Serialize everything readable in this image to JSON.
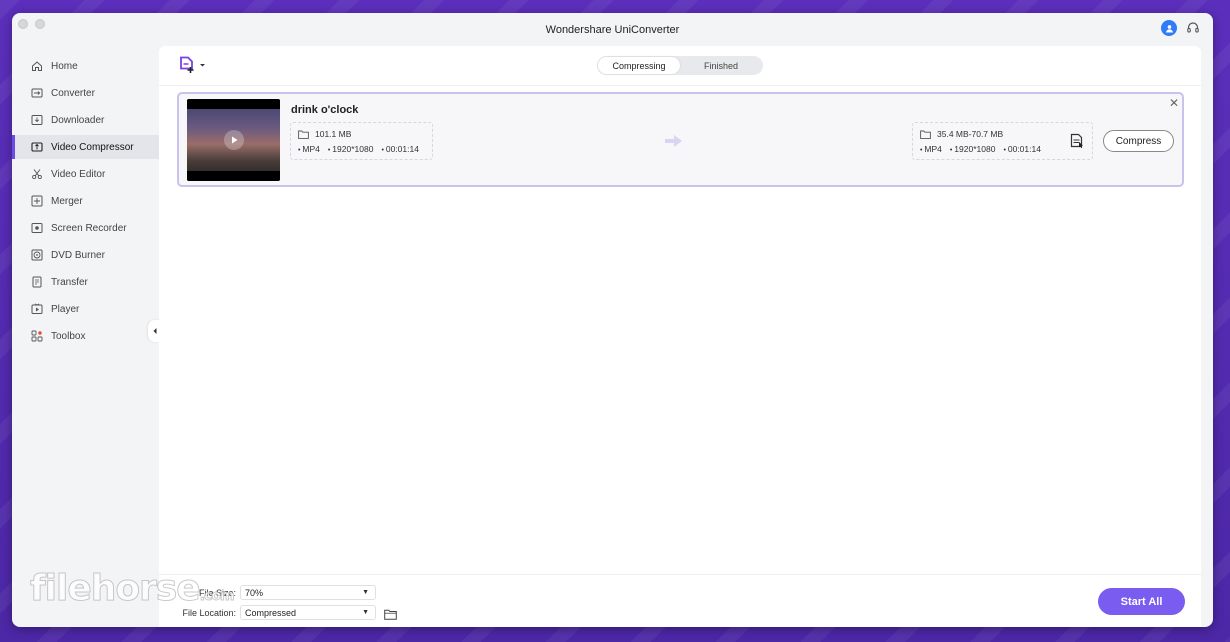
{
  "app": {
    "title": "Wondershare UniConverter"
  },
  "sidebar": {
    "items": [
      {
        "label": "Home",
        "icon": "home-icon"
      },
      {
        "label": "Converter",
        "icon": "converter-icon"
      },
      {
        "label": "Downloader",
        "icon": "downloader-icon"
      },
      {
        "label": "Video Compressor",
        "icon": "compressor-icon",
        "active": true
      },
      {
        "label": "Video Editor",
        "icon": "scissors-icon"
      },
      {
        "label": "Merger",
        "icon": "merger-icon"
      },
      {
        "label": "Screen Recorder",
        "icon": "screen-recorder-icon"
      },
      {
        "label": "DVD Burner",
        "icon": "disc-icon"
      },
      {
        "label": "Transfer",
        "icon": "transfer-icon"
      },
      {
        "label": "Player",
        "icon": "player-icon"
      },
      {
        "label": "Toolbox",
        "icon": "toolbox-icon"
      }
    ]
  },
  "tabs": [
    {
      "label": "Compressing",
      "active": true
    },
    {
      "label": "Finished",
      "active": false
    }
  ],
  "task": {
    "name": "drink o'clock",
    "source": {
      "size": "101.1 MB",
      "format": "MP4",
      "resolution": "1920*1080",
      "duration": "00:01:14"
    },
    "target": {
      "size": "35.4 MB-70.7 MB",
      "format": "MP4",
      "resolution": "1920*1080",
      "duration": "00:01:14"
    },
    "compress_label": "Compress"
  },
  "footer": {
    "file_size_label": "File Size:",
    "file_size_value": "70%",
    "file_location_label": "File Location:",
    "file_location_value": "Compressed",
    "start_all_label": "Start  All"
  },
  "watermark": {
    "text": "filehorse",
    "suffix": ".com"
  },
  "colors": {
    "accent": "#7b5cf0",
    "user": "#2f7cf6",
    "background": "#5a2fb8"
  }
}
